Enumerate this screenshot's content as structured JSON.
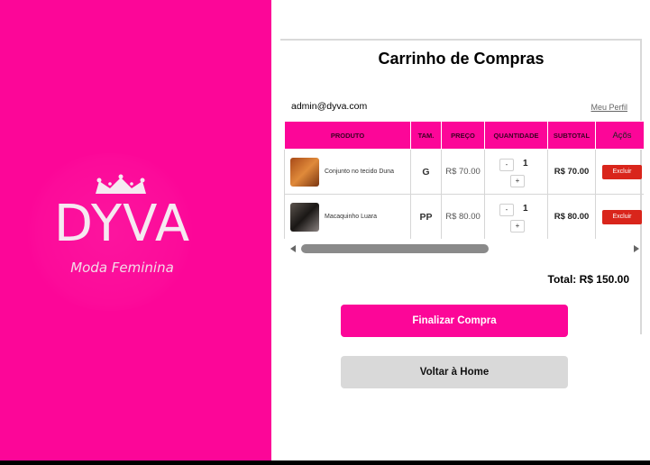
{
  "brand": {
    "logo": "DYVA",
    "tagline": "Moda Feminina",
    "color": "#fc0698"
  },
  "cart": {
    "title": "Carrinho de Compras",
    "user_email": "admin@dyva.com",
    "profile_link": "Meu Perfil",
    "columns": [
      "PRODUTO",
      "TAM.",
      "PREÇO",
      "QUANTIDADE",
      "SUBTOTAL",
      "Açõs"
    ],
    "items": [
      {
        "product": "Conjunto no tecido Duna",
        "size": "G",
        "price": "R$ 70.00",
        "quantity": "1",
        "subtotal": "R$ 70.00",
        "delete_label": "Excluir",
        "minus": "-",
        "plus": "+"
      },
      {
        "product": "Macaquinho Luara",
        "size": "PP",
        "price": "R$ 80.00",
        "quantity": "1",
        "subtotal": "R$ 80.00",
        "delete_label": "Excluir",
        "minus": "-",
        "plus": "+"
      }
    ],
    "total": "Total: R$ 150.00",
    "finish_button": "Finalizar Compra",
    "home_button": "Voltar à Home"
  }
}
